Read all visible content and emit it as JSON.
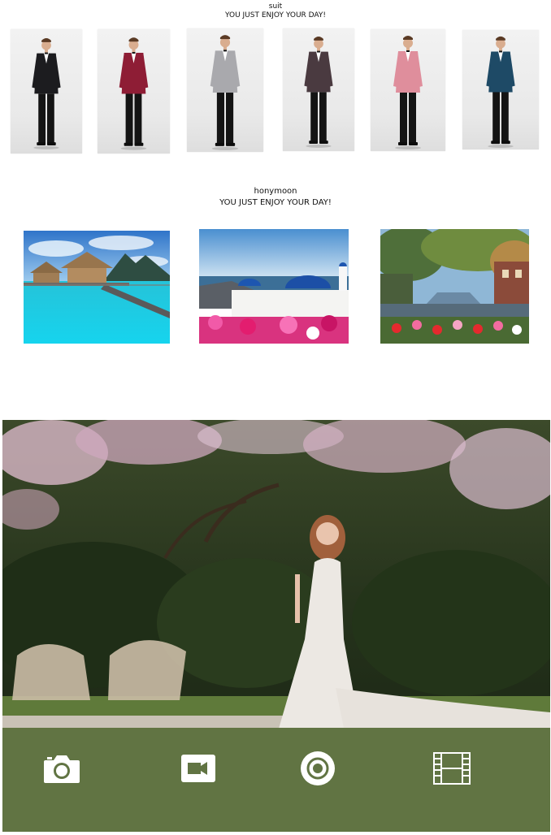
{
  "suit_section": {
    "title": "suit",
    "tagline": "YOU JUST ENJOY YOUR DAY!",
    "items": [
      {
        "jacket_color": "#1c1c1f"
      },
      {
        "jacket_color": "#8e1d35"
      },
      {
        "jacket_color": "#a9a9ad"
      },
      {
        "jacket_color": "#4a3a40"
      },
      {
        "jacket_color": "#df8e9c"
      },
      {
        "jacket_color": "#1e4a66"
      }
    ]
  },
  "honeymoon_section": {
    "title": "honymoon",
    "tagline": "YOU JUST ENJOY YOUR DAY!",
    "photos": [
      {
        "scene": "overwater-bungalows"
      },
      {
        "scene": "santorini-domes"
      },
      {
        "scene": "canal-flowers"
      }
    ]
  },
  "toolbar": {
    "background": "#617443",
    "buttons": [
      {
        "icon": "camera-icon"
      },
      {
        "icon": "video-camera-icon"
      },
      {
        "icon": "record-icon"
      },
      {
        "icon": "film-strip-icon"
      }
    ]
  }
}
